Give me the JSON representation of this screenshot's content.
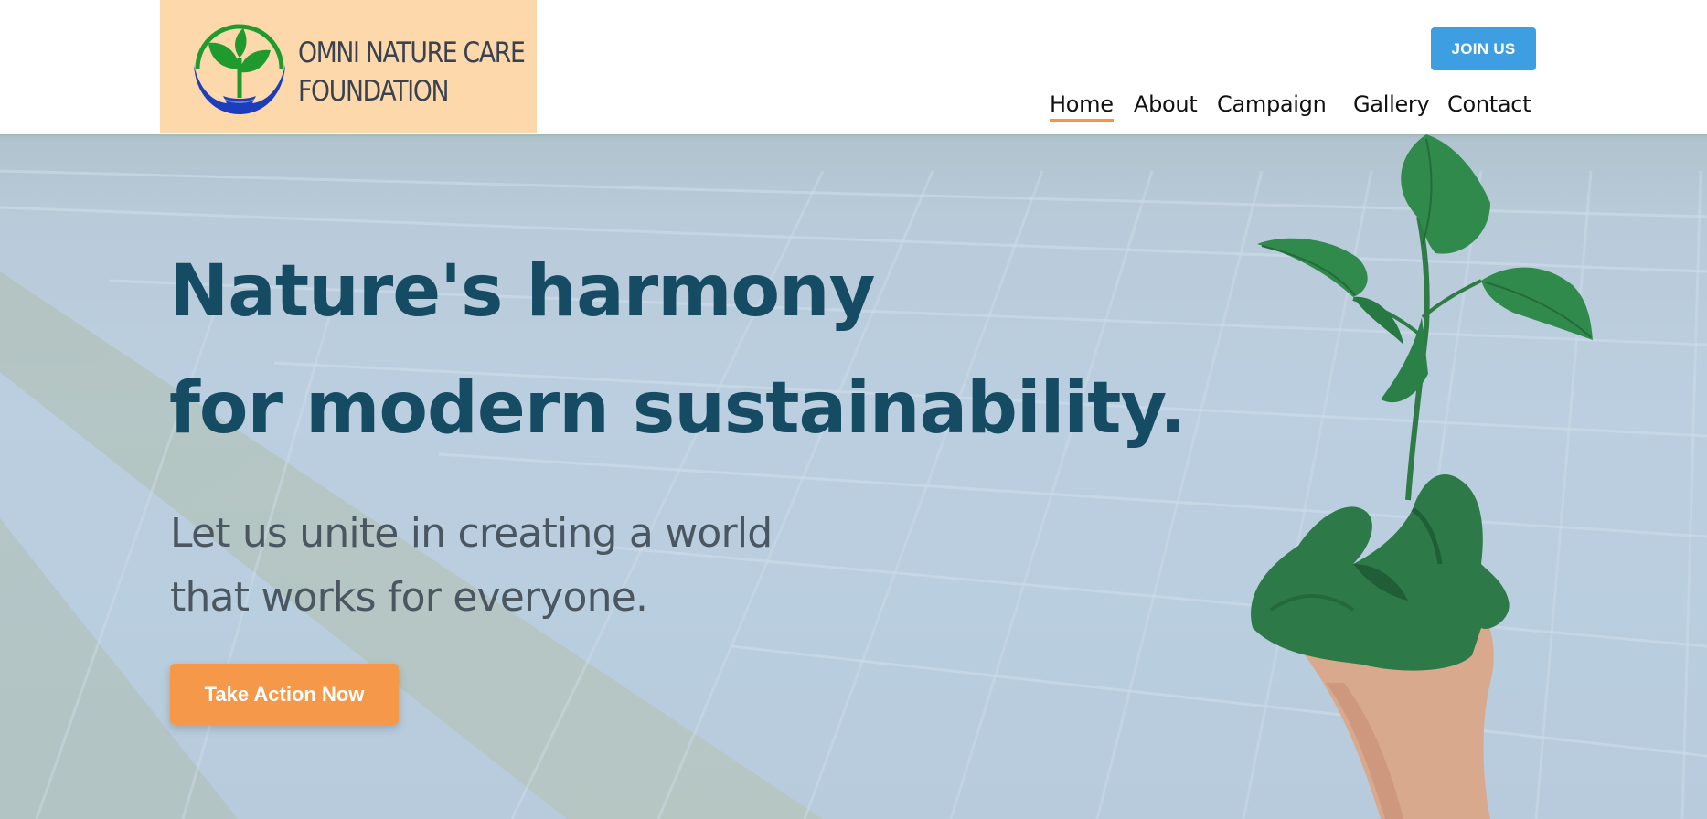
{
  "brand": {
    "name_line1": "OMNI NATURE CARE",
    "name_line2": "FOUNDATION",
    "logo_icon": "sprout-in-hands-icon",
    "logo_bg": "#fdd8ab"
  },
  "header": {
    "join_label": "JOIN US",
    "join_color": "#3d9fe2"
  },
  "nav": {
    "items": [
      {
        "label": "Home",
        "active": true
      },
      {
        "label": "About"
      },
      {
        "label": "Campaign"
      },
      {
        "label": "Gallery"
      },
      {
        "label": "Contact"
      }
    ],
    "active_underline": "#f3954a"
  },
  "hero": {
    "title_line1": "Nature's harmony",
    "title_line2": "for modern sustainability.",
    "subtitle_line1": "Let us unite in creating a world",
    "subtitle_line2": "that works for everyone.",
    "cta_label": "Take Action Now",
    "cta_color": "#f5984a",
    "title_color": "#164c63",
    "background_image": "solar-panels-field",
    "foreground_image": "green-painted-hand-holding-seedling"
  }
}
